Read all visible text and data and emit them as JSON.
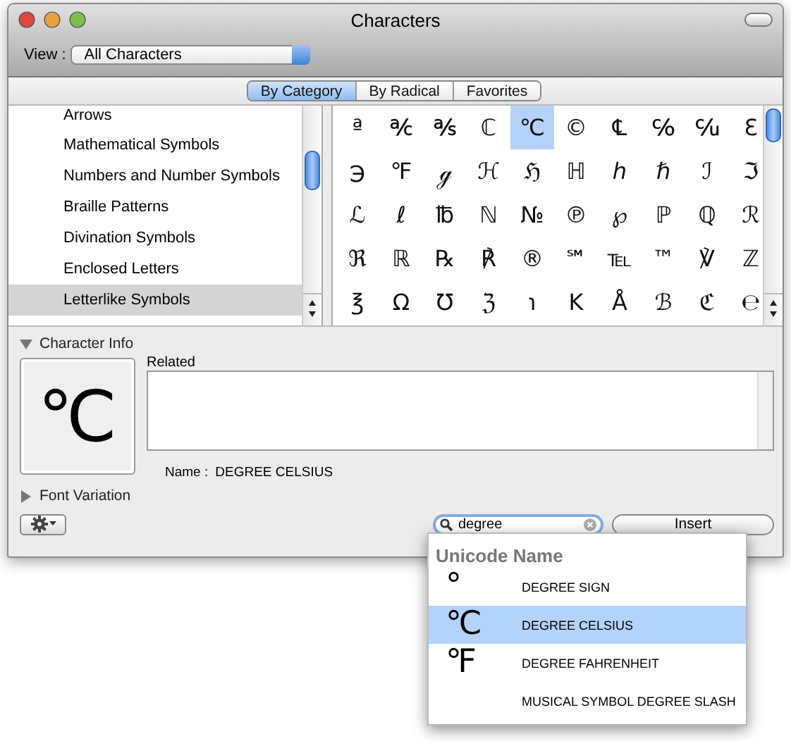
{
  "window": {
    "title": "Characters"
  },
  "view": {
    "label": "View :",
    "value": "All Characters"
  },
  "tabs": [
    {
      "label": "By Category",
      "selected": true
    },
    {
      "label": "By Radical",
      "selected": false
    },
    {
      "label": "Favorites",
      "selected": false
    }
  ],
  "categories": [
    {
      "label": "Arrows",
      "selected": false
    },
    {
      "label": "Mathematical Symbols",
      "selected": false
    },
    {
      "label": "Numbers and Number Symbols",
      "selected": false
    },
    {
      "label": "Braille Patterns",
      "selected": false
    },
    {
      "label": "Divination Symbols",
      "selected": false
    },
    {
      "label": "Enclosed Letters",
      "selected": false
    },
    {
      "label": "Letterlike Symbols",
      "selected": true
    }
  ],
  "characters": [
    {
      "char": "ª",
      "selected": false
    },
    {
      "char": "℀",
      "selected": false
    },
    {
      "char": "℁",
      "selected": false
    },
    {
      "char": "ℂ",
      "selected": false
    },
    {
      "char": "℃",
      "selected": true
    },
    {
      "char": "©",
      "selected": false
    },
    {
      "char": "℄",
      "selected": false
    },
    {
      "char": "℅",
      "selected": false
    },
    {
      "char": "℆",
      "selected": false
    },
    {
      "char": "ℇ",
      "selected": false
    },
    {
      "char": "℈",
      "selected": false
    },
    {
      "char": "℉",
      "selected": false
    },
    {
      "char": "ℊ",
      "selected": false
    },
    {
      "char": "ℋ",
      "selected": false
    },
    {
      "char": "ℌ",
      "selected": false
    },
    {
      "char": "ℍ",
      "selected": false
    },
    {
      "char": "ℎ",
      "selected": false
    },
    {
      "char": "ℏ",
      "selected": false
    },
    {
      "char": "ℐ",
      "selected": false
    },
    {
      "char": "ℑ",
      "selected": false
    },
    {
      "char": "ℒ",
      "selected": false
    },
    {
      "char": "ℓ",
      "selected": false
    },
    {
      "char": "℔",
      "selected": false
    },
    {
      "char": "ℕ",
      "selected": false
    },
    {
      "char": "№",
      "selected": false
    },
    {
      "char": "℗",
      "selected": false
    },
    {
      "char": "℘",
      "selected": false
    },
    {
      "char": "ℙ",
      "selected": false
    },
    {
      "char": "ℚ",
      "selected": false
    },
    {
      "char": "ℛ",
      "selected": false
    },
    {
      "char": "ℜ",
      "selected": false
    },
    {
      "char": "ℝ",
      "selected": false
    },
    {
      "char": "℞",
      "selected": false
    },
    {
      "char": "℟",
      "selected": false
    },
    {
      "char": "®",
      "selected": false
    },
    {
      "char": "℠",
      "selected": false
    },
    {
      "char": "℡",
      "selected": false
    },
    {
      "char": "™",
      "selected": false
    },
    {
      "char": "℣",
      "selected": false
    },
    {
      "char": "ℤ",
      "selected": false
    },
    {
      "char": "℥",
      "selected": false
    },
    {
      "char": "Ω",
      "selected": false
    },
    {
      "char": "℧",
      "selected": false
    },
    {
      "char": "ℨ",
      "selected": false
    },
    {
      "char": "℩",
      "selected": false
    },
    {
      "char": "K",
      "selected": false
    },
    {
      "char": "Å",
      "selected": false
    },
    {
      "char": "ℬ",
      "selected": false
    },
    {
      "char": "ℭ",
      "selected": false
    },
    {
      "char": "℮",
      "selected": false
    }
  ],
  "character_info": {
    "label": "Character Info",
    "expanded": true,
    "glyph": "℃",
    "related_label": "Related",
    "name_label": "Name :",
    "name": "DEGREE CELSIUS"
  },
  "font_variation": {
    "label": "Font Variation",
    "expanded": false
  },
  "search": {
    "value": "degree"
  },
  "insert_button": "Insert",
  "results": {
    "heading": "Unicode Name",
    "items": [
      {
        "glyph": "°",
        "name": "DEGREE SIGN",
        "selected": false
      },
      {
        "glyph": "℃",
        "name": "DEGREE CELSIUS",
        "selected": true
      },
      {
        "glyph": "℉",
        "name": "DEGREE FAHRENHEIT",
        "selected": false
      },
      {
        "name": "MUSICAL SYMBOL DEGREE SLASH",
        "selected": false
      }
    ]
  }
}
